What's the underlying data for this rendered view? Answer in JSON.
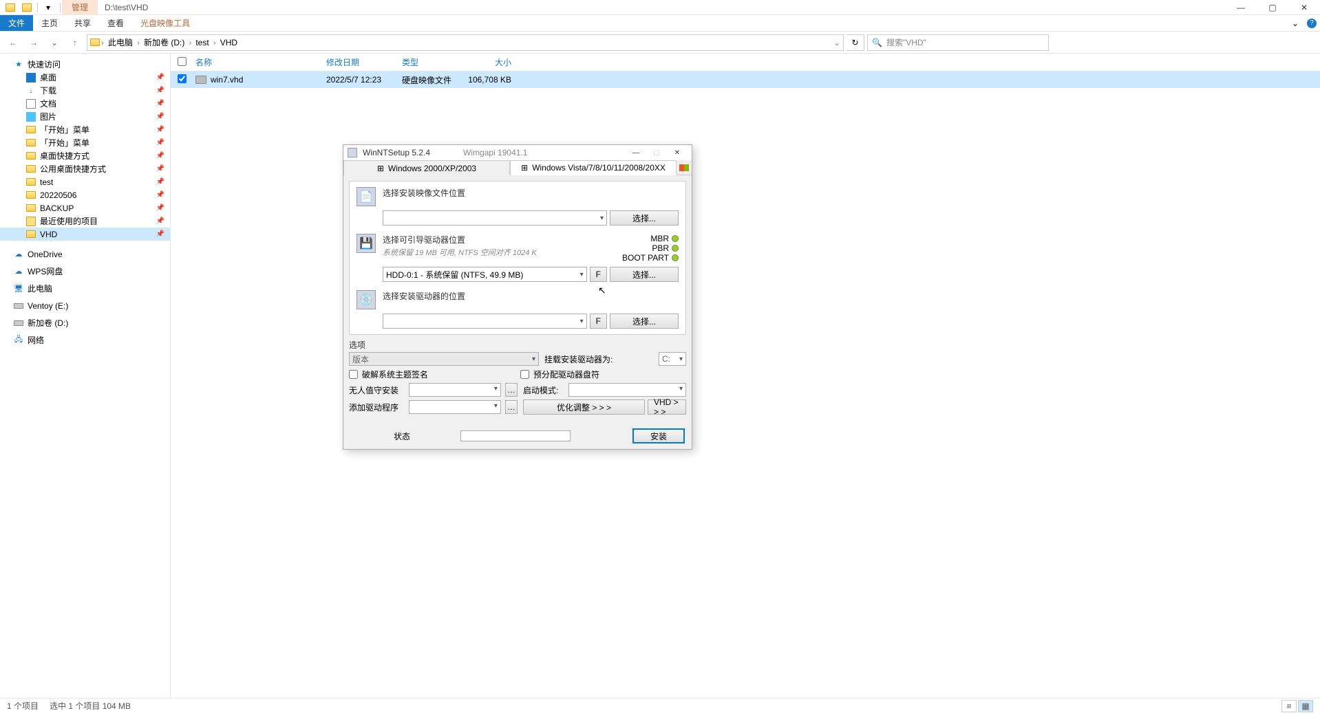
{
  "explorer": {
    "title_path": "D:\\test\\VHD",
    "ctx_tab": "管理",
    "ribbon": {
      "file": "文件",
      "home": "主页",
      "share": "共享",
      "view": "查看",
      "tool": "光盘映像工具"
    },
    "breadcrumb": [
      "此电脑",
      "新加卷 (D:)",
      "test",
      "VHD"
    ],
    "search_placeholder": "搜索\"VHD\"",
    "columns": {
      "name": "名称",
      "date": "修改日期",
      "type": "类型",
      "size": "大小"
    },
    "file": {
      "name": "win7.vhd",
      "date": "2022/5/7 12:23",
      "type": "硬盘映像文件",
      "size": "106,708 KB"
    },
    "sidebar": {
      "quick": "快速访问",
      "items": [
        "桌面",
        "下载",
        "文档",
        "图片",
        "「开始」菜单",
        "「开始」菜单",
        "桌面快捷方式",
        "公用桌面快捷方式",
        "test",
        "20220506",
        "BACKUP",
        "最近使用的项目",
        "VHD"
      ],
      "onedrive": "OneDrive",
      "wps": "WPS网盘",
      "thispc": "此电脑",
      "ventoy": "Ventoy (E:)",
      "newvol": "新加卷 (D:)",
      "network": "网络"
    },
    "status": {
      "count": "1 个项目",
      "sel": "选中 1 个项目 104 MB"
    }
  },
  "dialog": {
    "title": "WinNTSetup 5.2.4",
    "subtitle": "Wimgapi 19041.1",
    "tab1": "Windows 2000/XP/2003",
    "tab2": "Windows Vista/7/8/10/11/2008/20XX",
    "sec1": {
      "title": "选择安装映像文件位置",
      "select": "选择..."
    },
    "sec2": {
      "title": "选择可引导驱动器位置",
      "sub": "系统保留 19 MB 可用, NTFS 空间对齐 1024 K",
      "combo": "HDD-0:1 - 系统保留 (NTFS, 49.9 MB)",
      "f": "F",
      "select": "选择...",
      "mbr": "MBR",
      "pbr": "PBR",
      "boot": "BOOT PART"
    },
    "sec3": {
      "title": "选择安装驱动器的位置",
      "f": "F",
      "select": "选择..."
    },
    "opt": {
      "title": "选项",
      "version": "版本",
      "mount": "挂载安装驱动器为:",
      "mount_val": "C:",
      "crack": "破解系统主题签名",
      "prealloc": "预分配驱动器盘符",
      "unattend": "无人值守安装",
      "bootmode": "启动模式:",
      "adddrv": "添加驱动程序",
      "optimize": "优化调整 > > >",
      "vhd": "VHD > > >"
    },
    "footer": {
      "status": "状态",
      "install": "安装"
    }
  }
}
